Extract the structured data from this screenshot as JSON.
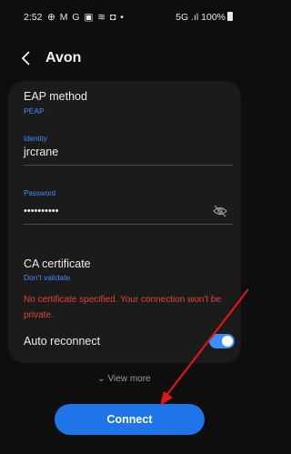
{
  "status_bar": {
    "time": "2:52",
    "icons": "⊕ M G ▣ ≋ ◘ •",
    "network": "5G .ıl 100%"
  },
  "header": {
    "back_icon": "chevron-left-icon",
    "title": "Avon"
  },
  "form": {
    "eap_method_label": "EAP method",
    "eap_method_value": "PEAP",
    "identity_label": "Identity",
    "identity_value": "jrcrane",
    "password_label": "Password",
    "password_value": "••••••••••",
    "ca_cert_label": "CA certificate",
    "ca_cert_value": "Don't validate",
    "warning": "No certificate specified. Your connection won't be private.",
    "auto_reconnect_label": "Auto reconnect",
    "auto_reconnect_on": true
  },
  "view_more": "⌄ View more",
  "connect_label": "Connect",
  "colors": {
    "accent": "#3d8dff",
    "button": "#1f74e8",
    "warning": "#e0463c",
    "annotation_arrow": "#e01515"
  }
}
